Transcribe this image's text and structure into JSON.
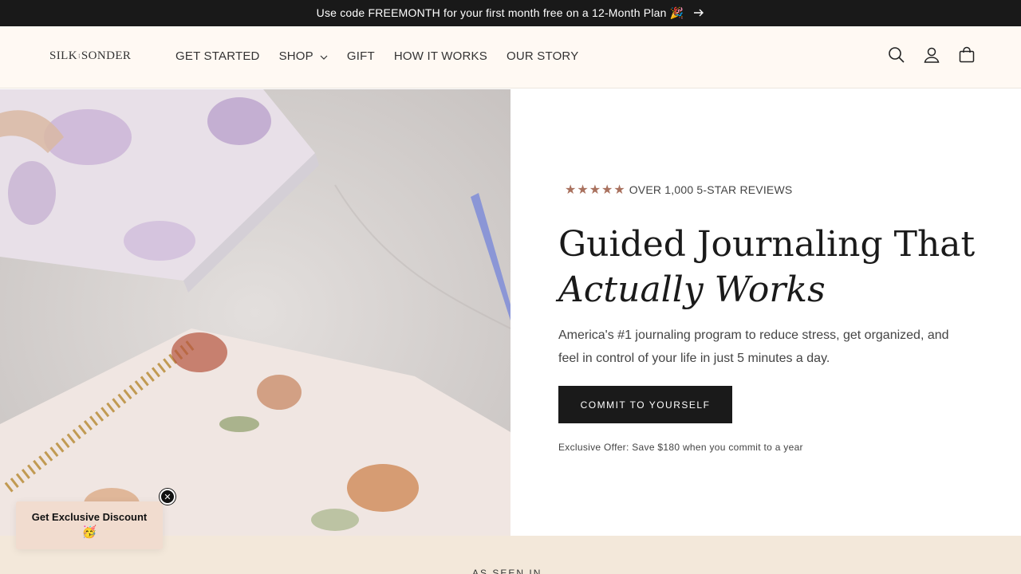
{
  "announcement": {
    "text": "Use code FREEMONTH for your first month free on a 12-Month Plan 🎉",
    "arrow_icon": "arrow-right-icon"
  },
  "header": {
    "logo_text_left": "SILK",
    "logo_separator": "⁝",
    "logo_text_right": "SONDER",
    "nav": [
      {
        "label": "GET STARTED"
      },
      {
        "label": "SHOP",
        "has_dropdown": true
      },
      {
        "label": "GIFT"
      },
      {
        "label": "HOW IT WORKS"
      },
      {
        "label": "OUR STORY"
      }
    ],
    "icons": [
      "search-icon",
      "account-icon",
      "cart-icon"
    ]
  },
  "hero": {
    "rating_stars": 5,
    "reviews_label": "OVER 1,000 5-STAR REVIEWS",
    "headline_line1": "Guided Journaling That",
    "headline_line2": "Actually Works",
    "description": "America's #1 journaling program to reduce stress, get organized, and feel in control of your life in just 5 minutes a day.",
    "cta_label": "COMMIT TO YOURSELF",
    "offer_text": "Exclusive Offer: Save $180 when you commit to a year"
  },
  "popup": {
    "label": "Get Exclusive Discount",
    "emoji": "🥳",
    "close_icon": "close-icon"
  },
  "section_peek": {
    "label": "AS SEEN IN"
  },
  "colors": {
    "announcement_bg": "#191919",
    "header_bg": "#fff9f3",
    "star": "#a9715e",
    "cta_bg": "#1a1a1a",
    "popup_bg": "#f1dccf",
    "band_bg": "#f3e8da"
  }
}
